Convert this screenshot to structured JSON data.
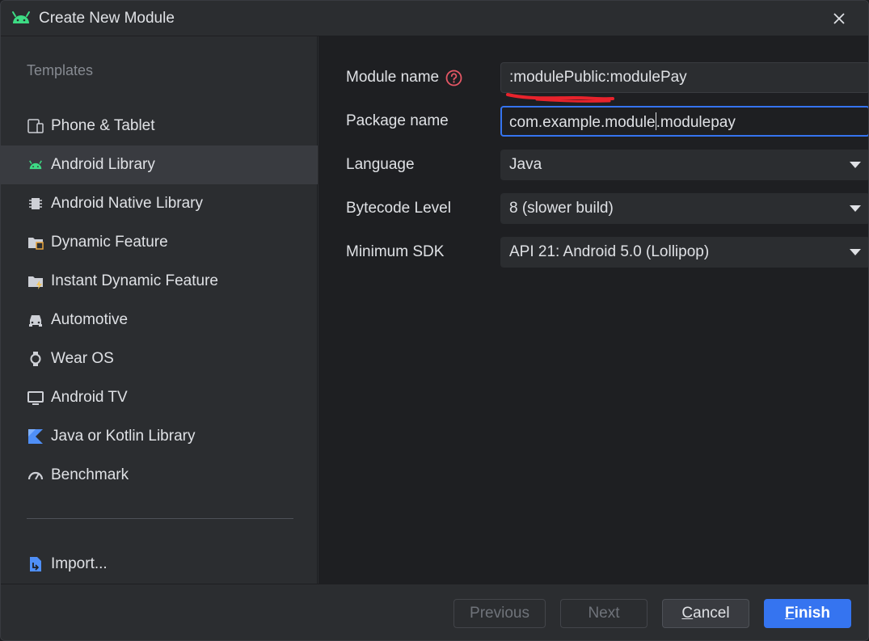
{
  "window": {
    "title": "Create New Module"
  },
  "sidebar": {
    "header": "Templates",
    "items": [
      {
        "label": "Phone & Tablet",
        "icon": "phone-tablet-icon"
      },
      {
        "label": "Android Library",
        "icon": "android-icon",
        "selected": true
      },
      {
        "label": "Android Native Library",
        "icon": "chip-icon"
      },
      {
        "label": "Dynamic Feature",
        "icon": "folder-feature-icon"
      },
      {
        "label": "Instant Dynamic Feature",
        "icon": "folder-instant-icon"
      },
      {
        "label": "Automotive",
        "icon": "car-icon"
      },
      {
        "label": "Wear OS",
        "icon": "watch-icon"
      },
      {
        "label": "Android TV",
        "icon": "tv-icon"
      },
      {
        "label": "Java or Kotlin Library",
        "icon": "kotlin-icon"
      },
      {
        "label": "Benchmark",
        "icon": "gauge-icon"
      }
    ],
    "import_label": "Import..."
  },
  "form": {
    "module_name": {
      "label": "Module name",
      "value": ":modulePublic:modulePay"
    },
    "package_name": {
      "label": "Package name",
      "value_before_cursor": "com.example.module",
      "value_after_cursor": ".modulepay"
    },
    "language": {
      "label": "Language",
      "value": "Java"
    },
    "bytecode_level": {
      "label": "Bytecode Level",
      "value": "8 (slower build)"
    },
    "minimum_sdk": {
      "label": "Minimum SDK",
      "value": "API 21: Android 5.0 (Lollipop)"
    }
  },
  "footer": {
    "previous": "Previous",
    "next": "Next",
    "cancel_mnemonic": "C",
    "cancel_rest": "ancel",
    "finish_mnemonic": "F",
    "finish_rest": "inish"
  },
  "colors": {
    "accent": "#3574f0",
    "android_green": "#3ddc84",
    "help_red": "#e55765",
    "annotation_red": "#e8232c"
  }
}
